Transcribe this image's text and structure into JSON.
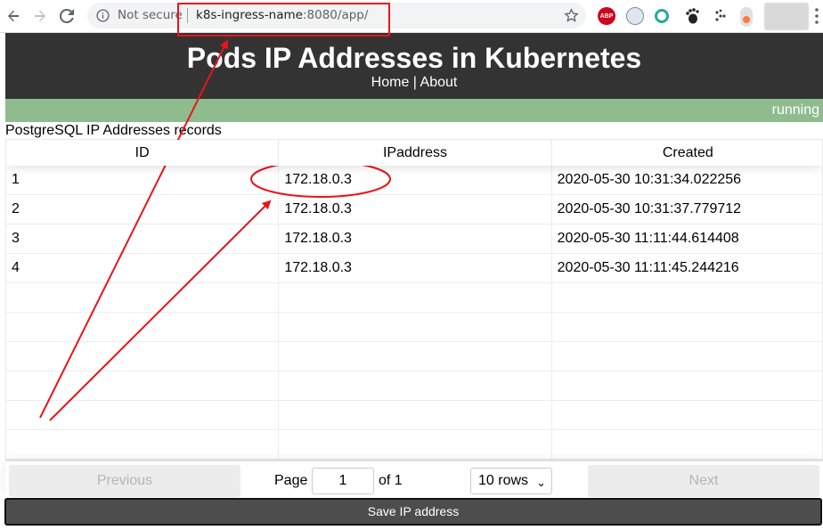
{
  "browser": {
    "security_label": "Not secure",
    "url_host": "k8s-ingress-name",
    "url_rest": ":8080/app/",
    "extensions": [
      {
        "name": "adblock-plus-icon",
        "label": "ABP"
      }
    ]
  },
  "header": {
    "title": "Pods IP Addresses in Kubernetes",
    "nav_home": "Home",
    "nav_sep": " | ",
    "nav_about": "About"
  },
  "status": {
    "text": "running",
    "color": "#8fbc8f"
  },
  "section": {
    "title": "PostgreSQL IP Addresses records"
  },
  "table": {
    "columns": [
      "ID",
      "IPaddress",
      "Created"
    ],
    "rows": [
      [
        "1",
        "172.18.0.3",
        "2020-05-30 10:31:34.022256"
      ],
      [
        "2",
        "172.18.0.3",
        "2020-05-30 10:31:37.779712"
      ],
      [
        "3",
        "172.18.0.3",
        "2020-05-30 11:11:44.614408"
      ],
      [
        "4",
        "172.18.0.3",
        "2020-05-30 11:11:45.244216"
      ]
    ]
  },
  "pagination": {
    "previous": "Previous",
    "page_label": "Page",
    "page_value": "1",
    "of_label": "of 1",
    "rows_select": "10 rows",
    "next": "Next"
  },
  "actions": {
    "save": "Save IP address"
  },
  "annotation": {
    "color": "#e8141a"
  }
}
